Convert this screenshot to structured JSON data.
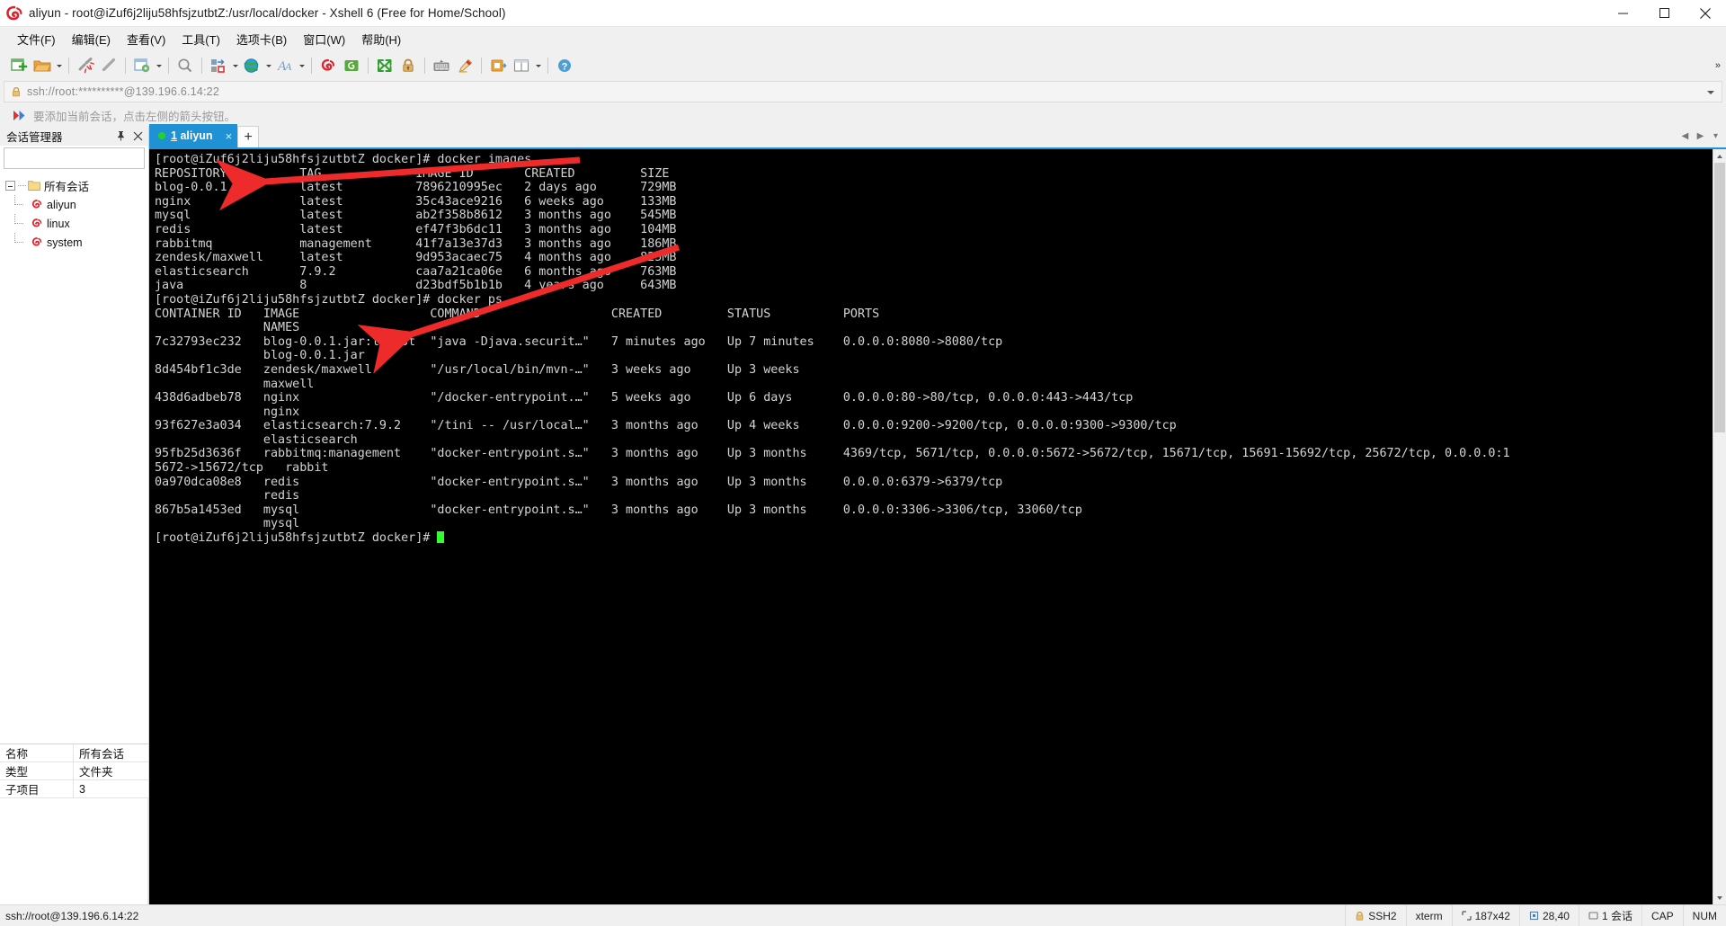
{
  "window": {
    "title": "aliyun - root@iZuf6j2liju58hfsjzutbtZ:/usr/local/docker - Xshell 6 (Free for Home/School)",
    "app_icon": "xshell-logo-icon",
    "minimize_label": "Minimize",
    "maximize_label": "Maximize",
    "close_label": "Close"
  },
  "menubar": {
    "items": [
      {
        "label": "文件(F)",
        "name": "menu-file"
      },
      {
        "label": "编辑(E)",
        "name": "menu-edit"
      },
      {
        "label": "查看(V)",
        "name": "menu-view"
      },
      {
        "label": "工具(T)",
        "name": "menu-tools"
      },
      {
        "label": "选项卡(B)",
        "name": "menu-tab"
      },
      {
        "label": "窗口(W)",
        "name": "menu-window"
      },
      {
        "label": "帮助(H)",
        "name": "menu-help"
      }
    ]
  },
  "toolbar": {
    "collapse_label": "»",
    "buttons": [
      "new-session-icon",
      "open-folder-icon",
      "disconnect-icon",
      "reconnect-icon",
      "session-properties-icon",
      "find-icon",
      "transfer-file-icon",
      "globe-icon",
      "font-icon",
      "xshell-icon",
      "xftp-icon",
      "fullscreen-icon",
      "lock-icon",
      "keyboard-icon",
      "highlight-icon",
      "compose-icon",
      "layout-icon",
      "help-icon"
    ]
  },
  "address_bar": {
    "lock_icon": "lock-icon",
    "value": "ssh://root:**********@139.196.6.14:22",
    "dropdown_icon": "chevron-down-icon"
  },
  "notice_bar": {
    "icon": "red-blue-arrow-icon",
    "text": "要添加当前会话，点击左侧的箭头按钮。"
  },
  "session_manager": {
    "title": "会话管理器",
    "pin_icon": "pin-icon",
    "close_icon": "close-icon",
    "search": {
      "value": "",
      "placeholder": "",
      "icon": "search-icon"
    },
    "tree": {
      "root": {
        "label": "所有会话",
        "icon": "folder-icon",
        "expanded": true
      },
      "children": [
        {
          "label": "aliyun",
          "icon": "xshell-session-icon"
        },
        {
          "label": "linux",
          "icon": "xshell-session-icon"
        },
        {
          "label": "system",
          "icon": "xshell-session-icon"
        }
      ]
    },
    "properties": [
      {
        "key": "名称",
        "value": "所有会话"
      },
      {
        "key": "类型",
        "value": "文件夹"
      },
      {
        "key": "子项目",
        "value": "3"
      }
    ]
  },
  "tabs": {
    "items": [
      {
        "index": "1",
        "label": "aliyun",
        "active": true,
        "status_dot": "#24d324",
        "close_icon": "close-icon"
      }
    ],
    "add_label": "+",
    "nav_prev": "◀",
    "nav_next": "▶",
    "nav_menu": "▾"
  },
  "terminal": {
    "prompt_host": "[root@iZuf6j2liju58hfsjzutbtZ docker]#",
    "lines": [
      "[root@iZuf6j2liju58hfsjzutbtZ docker]# docker images",
      "REPOSITORY          TAG             IMAGE ID       CREATED         SIZE",
      "blog-0.0.1.jar      latest          7896210995ec   2 days ago      729MB",
      "nginx               latest          35c43ace9216   6 weeks ago     133MB",
      "mysql               latest          ab2f358b8612   3 months ago    545MB",
      "redis               latest          ef47f3b6dc11   3 months ago    104MB",
      "rabbitmq            management      41f7a13e37d3   3 months ago    186MB",
      "zendesk/maxwell     latest          9d953acaec75   4 months ago    825MB",
      "elasticsearch       7.9.2           caa7a21ca06e   6 months ago    763MB",
      "java                8               d23bdf5b1b1b   4 years ago     643MB",
      "[root@iZuf6j2liju58hfsjzutbtZ docker]# docker ps",
      "CONTAINER ID   IMAGE                  COMMAND                  CREATED         STATUS          PORTS",
      "               NAMES",
      "7c32793ec232   blog-0.0.1.jar:latest  \"java -Djava.securit…\"   7 minutes ago   Up 7 minutes    0.0.0.0:8080->8080/tcp",
      "               blog-0.0.1.jar",
      "8d454bf1c3de   zendesk/maxwell        \"/usr/local/bin/mvn-…\"   3 weeks ago     Up 3 weeks",
      "               maxwell",
      "438d6adbeb78   nginx                  \"/docker-entrypoint.…\"   5 weeks ago     Up 6 days       0.0.0.0:80->80/tcp, 0.0.0.0:443->443/tcp",
      "               nginx",
      "93f627e3a034   elasticsearch:7.9.2    \"/tini -- /usr/local…\"   3 months ago    Up 4 weeks      0.0.0.0:9200->9200/tcp, 0.0.0.0:9300->9300/tcp",
      "               elasticsearch",
      "95fb25d3636f   rabbitmq:management    \"docker-entrypoint.s…\"   3 months ago    Up 3 months     4369/tcp, 5671/tcp, 0.0.0.0:5672->5672/tcp, 15671/tcp, 15691-15692/tcp, 25672/tcp, 0.0.0.0:1",
      "5672->15672/tcp   rabbit",
      "0a970dca08e8   redis                  \"docker-entrypoint.s…\"   3 months ago    Up 3 months     0.0.0.0:6379->6379/tcp",
      "               redis",
      "867b5a1453ed   mysql                  \"docker-entrypoint.s…\"   3 months ago    Up 3 months     0.0.0.0:3306->3306/tcp, 33060/tcp",
      "               mysql",
      "[root@iZuf6j2liju58hfsjzutbtZ docker]# "
    ],
    "annotations": [
      {
        "name": "arrow-to-blog-image-row",
        "color": "#ee2b2b"
      },
      {
        "name": "arrow-to-blog-container-row",
        "color": "#ee2b2b"
      }
    ]
  },
  "statusbar": {
    "connection": "ssh://root@139.196.6.14:22",
    "security": {
      "icon": "lock-icon",
      "label": "SSH2"
    },
    "terminal_type": "xterm",
    "size": {
      "icon": "resize-icon",
      "label": "187x42"
    },
    "cursor": {
      "icon": "cursor-icon",
      "label": "28,40"
    },
    "sessions": "1 会话",
    "cap": "CAP",
    "num": "NUM"
  }
}
